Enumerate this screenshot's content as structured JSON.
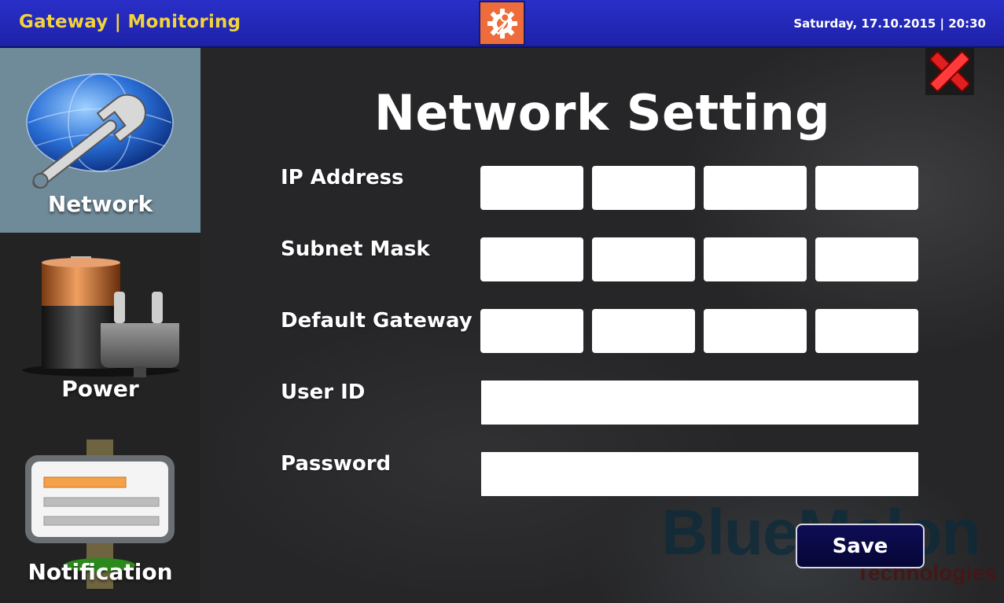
{
  "header": {
    "app_title": "Gateway | Monitoring",
    "settings_icon": "gear-wrench-icon",
    "datetime": "Saturday, 17.10.2015 | 20:30",
    "colors": {
      "bar": "#2a2fc8",
      "title": "#f3d33a",
      "settings_bg": "#ee6c3c"
    }
  },
  "sidebar": {
    "items": [
      {
        "label": "Network",
        "icon": "globe-wrench-icon",
        "active": true
      },
      {
        "label": "Power",
        "icon": "battery-plug-icon",
        "active": false
      },
      {
        "label": "Notification",
        "icon": "notice-board-icon",
        "active": false
      }
    ],
    "active_color": "#6f8a98"
  },
  "main": {
    "title": "Network Setting",
    "close_icon": "red-x-close-icon",
    "fields": {
      "ip_address": {
        "label": "IP Address",
        "values": [
          "",
          "",
          "",
          ""
        ]
      },
      "subnet_mask": {
        "label": "Subnet Mask",
        "values": [
          "",
          "",
          "",
          ""
        ]
      },
      "default_gateway": {
        "label": "Default Gateway",
        "values": [
          "",
          "",
          "",
          ""
        ]
      },
      "user_id": {
        "label": "User ID",
        "value": ""
      },
      "password": {
        "label": "Password",
        "value": ""
      }
    },
    "save_label": "Save",
    "watermark": {
      "brand": "BlueMelon",
      "sub": "Technologies"
    }
  }
}
